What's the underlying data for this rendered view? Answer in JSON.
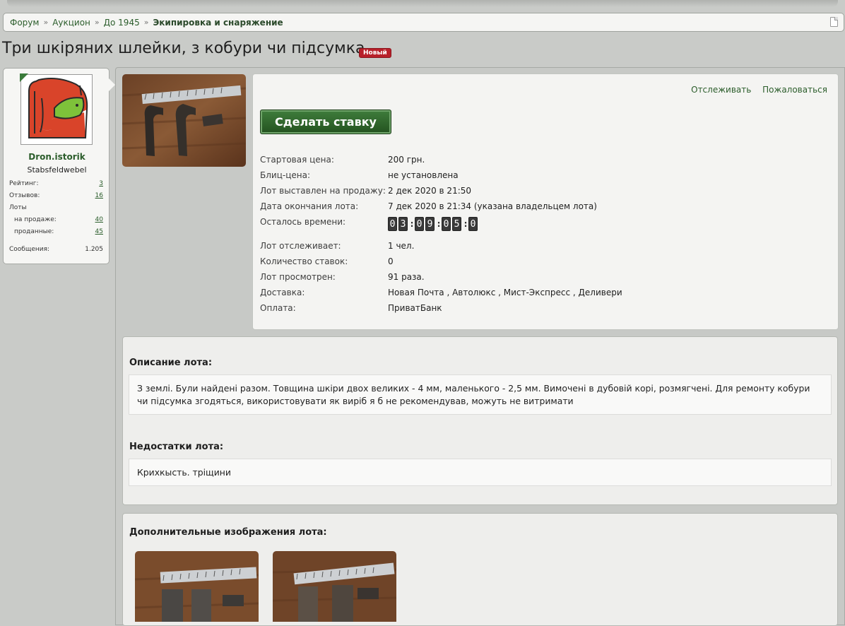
{
  "breadcrumb": {
    "items": [
      "Форум",
      "Аукцион",
      "До 1945"
    ],
    "separator": "»",
    "current": "Экипировка и снаряжение"
  },
  "page": {
    "title": "Три шкіряних шлейки, з кобури чи підсумка",
    "badge": "Новый"
  },
  "user": {
    "name": "Dron.istorik",
    "rank": "Stabsfeldwebel",
    "stats": [
      {
        "label": "Рейтинг:",
        "value": "3"
      },
      {
        "label": "Отзывов:",
        "value": "16"
      },
      {
        "label": "Лоты",
        "value": ""
      },
      {
        "label": "на продаже:",
        "value": "40"
      },
      {
        "label": "проданные:",
        "value": "45"
      },
      {
        "label": "Сообщения:",
        "value": "1.205"
      }
    ]
  },
  "lot": {
    "watch_label": "Отслеживать",
    "report_label": "Пожаловаться",
    "bid_button": "Сделать ставку",
    "fields": [
      {
        "label": "Стартовая цена:",
        "value": "200 грн."
      },
      {
        "label": "Блиц-цена:",
        "value": "не установлена"
      },
      {
        "label": "Лот выставлен на продажу:",
        "value": "2 дек 2020 в 21:50"
      },
      {
        "label": "Дата окончания лота:",
        "value": "7 дек 2020 в 21:34 (указана владельцем лота)"
      }
    ],
    "time_left_label": "Осталось времени:",
    "timer_digits": [
      "0",
      "3",
      ":",
      "0",
      "9",
      ":",
      "0",
      "5",
      ":",
      "0"
    ],
    "fields2": [
      {
        "label": "Лот отслеживает:",
        "value": "1 чел."
      },
      {
        "label": "Количество ставок:",
        "value": "0"
      },
      {
        "label": "Лот просмотрен:",
        "value": "91 раза."
      },
      {
        "label": "Доставка:",
        "value": "Новая Почта , Автолюкс , Мист-Экспресс , Деливери"
      },
      {
        "label": "Оплата:",
        "value": "ПриватБанк"
      }
    ]
  },
  "description": {
    "heading": "Описание лота:",
    "text": "З землі. Були найдені разом. Товщина шкіри двох великих - 4 мм, маленького - 2,5 мм. Вимочені в дубовій корі, розмягчені. Для ремонту кобури чи підсумка згодяться, використовувати як виріб я б не рекомендував, можуть не витримати",
    "defects_heading": "Недостатки лота:",
    "defects_text": "Крихкысть. тріщини"
  },
  "extra_images": {
    "heading": "Дополнительные изображения лота:"
  },
  "colors": {
    "accent": "#2b5d2b",
    "button": "#2f6a2c",
    "badge": "#b8202a",
    "background": "#c9cbc8"
  }
}
